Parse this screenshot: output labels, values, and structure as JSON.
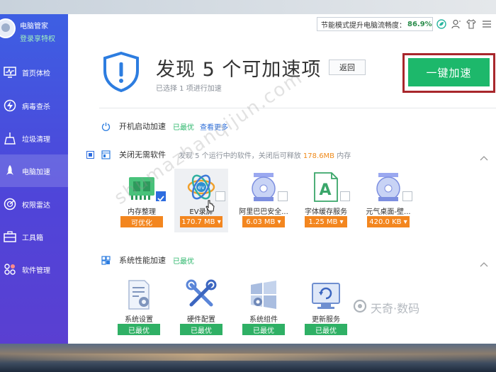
{
  "profile": {
    "name": "电脑管家",
    "subtitle": "登录享特权"
  },
  "sidebar": {
    "items": [
      {
        "label": "首页体检",
        "icon": "monitor-icon",
        "active": false
      },
      {
        "label": "病毒查杀",
        "icon": "lightning-icon",
        "active": false
      },
      {
        "label": "垃圾清理",
        "icon": "broom-icon",
        "active": false
      },
      {
        "label": "电脑加速",
        "icon": "rocket-icon",
        "active": true
      },
      {
        "label": "权限雷达",
        "icon": "radar-icon",
        "active": false
      },
      {
        "label": "工具箱",
        "icon": "toolbox-icon",
        "active": false
      },
      {
        "label": "软件管理",
        "icon": "apps-icon",
        "active": false
      }
    ]
  },
  "topbar": {
    "fps_label": "节能模式提升电脑流畅度：",
    "fps_value": "86.9%",
    "icons": [
      "leaf-icon",
      "user-icon",
      "shirt-icon",
      "menu-icon"
    ]
  },
  "header": {
    "title": "发现 5 个可加速项",
    "subtitle": "已选择 1 项进行加速",
    "back_label": "返回",
    "accelerate_label": "一键加速"
  },
  "sections": {
    "startup": {
      "title": "开机启动加速",
      "status": "已最优",
      "link": "查看更多"
    },
    "software": {
      "title": "关闭无需软件",
      "desc_prefix": "发现 5 个运行中的软件，关闭后可释放",
      "desc_amount": "178.6MB",
      "desc_suffix": "内存",
      "apps": [
        {
          "label": "内存整理",
          "tag": "可优化",
          "icon": "memory-chip-icon",
          "checked": true
        },
        {
          "label": "EV录屏",
          "tag": "170.7 MB ▾",
          "icon": "ev-recorder-icon",
          "checked": false
        },
        {
          "label": "阿里巴巴安全...",
          "tag": "6.03 MB ▾",
          "icon": "cd-installer-icon",
          "checked": false
        },
        {
          "label": "字体缓存服务",
          "tag": "1.25 MB ▾",
          "icon": "font-file-icon",
          "checked": false
        },
        {
          "label": "元气桌面-壁...",
          "tag": "420.0 KB ▾",
          "icon": "cd-installer-icon",
          "checked": false
        }
      ]
    },
    "performance": {
      "title": "系统性能加速",
      "status": "已最优",
      "items": [
        {
          "label": "系统设置",
          "tag": "已最优",
          "icon": "settings-doc-icon"
        },
        {
          "label": "硬件配置",
          "tag": "已最优",
          "icon": "wrench-tools-icon"
        },
        {
          "label": "系统组件",
          "tag": "已最优",
          "icon": "windows-gear-icon"
        },
        {
          "label": "更新服务",
          "tag": "已最优",
          "icon": "refresh-icon"
        }
      ]
    }
  },
  "watermark": {
    "text": "shumazhanqijun.com",
    "brand": "天奇·数码"
  },
  "colors": {
    "sidebar_top": "#3d5fe3",
    "sidebar_bottom": "#5a3fd1",
    "accent_green": "#1db86b",
    "tag_orange": "#f3861f",
    "highlight_red": "#a8262b"
  }
}
